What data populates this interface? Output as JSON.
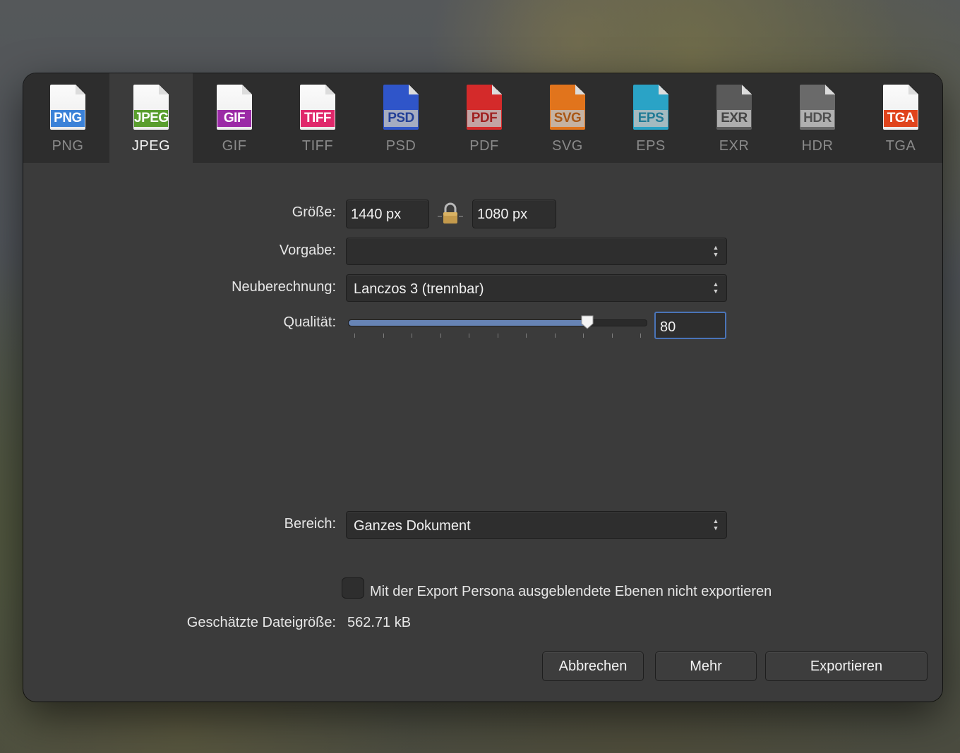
{
  "tabs": [
    {
      "badge": "PNG",
      "label": "PNG",
      "color": "#3b82d8"
    },
    {
      "badge": "JPEG",
      "label": "JPEG",
      "color": "#5a9e2e"
    },
    {
      "badge": "GIF",
      "label": "GIF",
      "color": "#9b2aa6"
    },
    {
      "badge": "TIFF",
      "label": "TIFF",
      "color": "#e0286b"
    },
    {
      "badge": "PSD",
      "label": "PSD",
      "color": "#2f55c9"
    },
    {
      "badge": "PDF",
      "label": "PDF",
      "color": "#d42a2a"
    },
    {
      "badge": "SVG",
      "label": "SVG",
      "color": "#e1741c"
    },
    {
      "badge": "EPS",
      "label": "EPS",
      "color": "#2aa3c6"
    },
    {
      "badge": "EXR",
      "label": "EXR",
      "color": "#5a5a5a"
    },
    {
      "badge": "HDR",
      "label": "HDR",
      "color": "#6a6a6a"
    },
    {
      "badge": "TGA",
      "label": "TGA",
      "color": "#e0441c"
    }
  ],
  "selected_tab": "JPEG",
  "size": {
    "label": "Größe:",
    "width": "1440 px",
    "height": "1080 px"
  },
  "preset": {
    "label": "Vorgabe:",
    "value": ""
  },
  "resample": {
    "label": "Neuberechnung:",
    "value": "Lanczos 3 (trennbar)"
  },
  "quality": {
    "label": "Qualität:",
    "value": "80",
    "level": 0.8
  },
  "area": {
    "label": "Bereich:",
    "value": "Ganzes Dokument"
  },
  "hidden_layers": {
    "label": "Mit der Export Persona ausgeblendete Ebenen nicht exportieren",
    "checked": false
  },
  "filesize": {
    "label": "Geschätzte Dateigröße:",
    "value": "562.71 kB"
  },
  "buttons": {
    "cancel": "Abbrechen",
    "more": "Mehr",
    "export": "Exportieren"
  }
}
